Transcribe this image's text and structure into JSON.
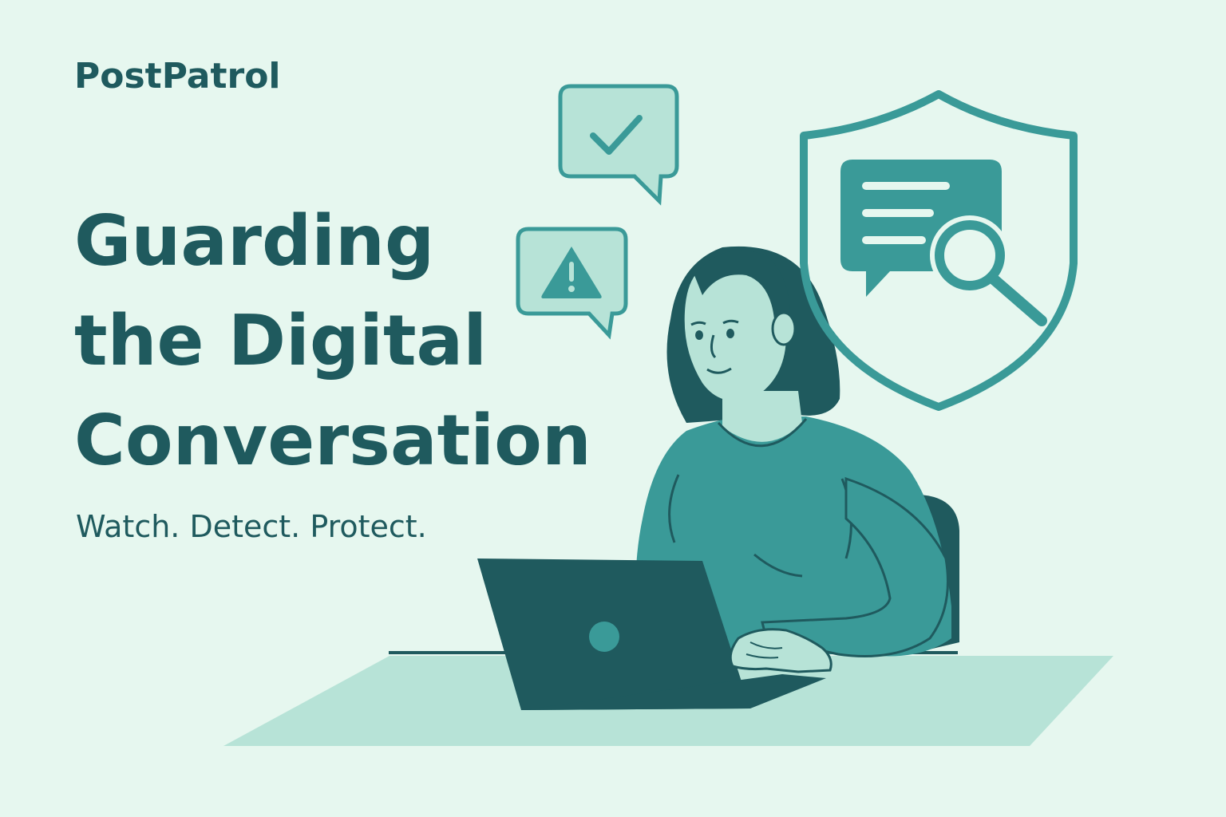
{
  "brand": {
    "name": "PostPatrol"
  },
  "hero": {
    "headline_lines": [
      "Guarding",
      "the Digital",
      "Conversation"
    ],
    "tagline": "Watch. Detect. Protect."
  },
  "icons": {
    "approved_bubble": "check-icon",
    "warning_bubble": "warning-icon",
    "shield": "shield-icon",
    "magnifier": "magnifier-icon",
    "laptop": "laptop-icon"
  },
  "colors": {
    "background": "#e6f7ef",
    "text_dark": "#1f5a5e",
    "teal": "#3a9a98",
    "teal_dark": "#1f5a5e",
    "teal_light": "#b7e3d7",
    "skin": "#b7e3d7"
  }
}
